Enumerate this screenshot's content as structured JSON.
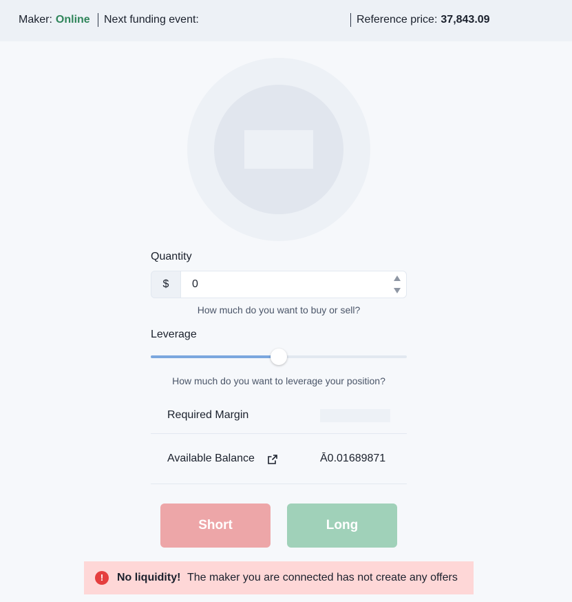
{
  "header": {
    "maker_label": "Maker:",
    "maker_status": "Online",
    "funding_label": "Next funding event:",
    "funding_value": "",
    "reference_label": "Reference price:",
    "reference_value": "37,843.09"
  },
  "form": {
    "quantity_label": "Quantity",
    "currency_symbol": "$",
    "quantity_value": "0",
    "quantity_help": "How much do you want to buy or sell?",
    "leverage_label": "Leverage",
    "leverage_fraction": 0.5,
    "leverage_help": "How much do you want to leverage your position?"
  },
  "summary": {
    "required_margin_label": "Required Margin",
    "required_margin_value": "",
    "available_balance_label": "Available Balance",
    "available_balance_value": "Ā0.01689871"
  },
  "actions": {
    "short_label": "Short",
    "long_label": "Long"
  },
  "alert": {
    "title": "No liquidity!",
    "description": "The maker you are connected has not create any offers",
    "icon": "!"
  },
  "colors": {
    "online": "#2f855a",
    "short": "#eda6a8",
    "long": "#a0d1b9",
    "alert_bg": "#fed7d7",
    "alert_icon": "#e53e3e",
    "slider_fill": "#7ba7de"
  }
}
